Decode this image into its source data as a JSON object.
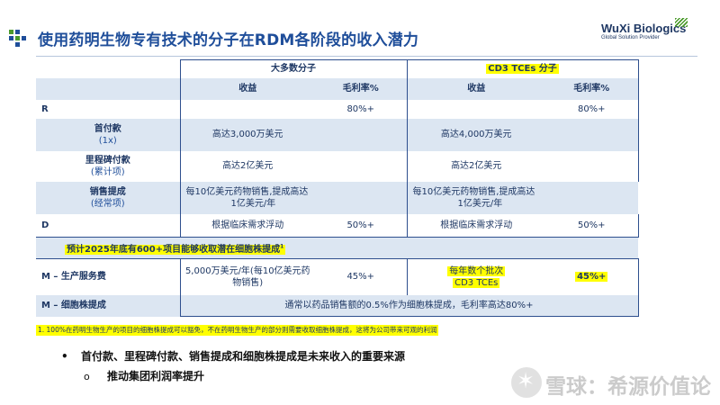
{
  "slide": {
    "title": "使用药明生物专有技术的分子在RDM各阶段的收入潜力",
    "brand": {
      "name": "WuXi Biologics",
      "tagline": "Global Solution Provider"
    },
    "colors": {
      "accent": "#1f4e9a",
      "band": "#dce6f2",
      "highlight": "#ffff00",
      "logo_green": "#4a9a2a"
    }
  },
  "table": {
    "group_headers": {
      "majority": "大多数分子",
      "cd3": "CD3 TCEs 分子"
    },
    "col_headers": {
      "revenue": "收益",
      "gross_margin": "毛利率%"
    },
    "rows": {
      "r": {
        "label": "R",
        "gm_majority": "80%+",
        "gm_cd3": "80%+"
      },
      "upfront": {
        "label": "首付款",
        "sub": "(1x)",
        "rev_majority": "高达3,000万美元",
        "rev_cd3": "高达4,000万美元"
      },
      "milestone": {
        "label": "里程碑付款",
        "sub": "(累计项)",
        "rev_majority": "高达2亿美元",
        "rev_cd3": "高达2亿美元"
      },
      "royalty": {
        "label": "销售提成",
        "sub": "(经常项)",
        "rev_majority_1": "每10亿美元药物销售,提成高达",
        "rev_majority_2": "1亿美元/年",
        "rev_cd3_1": "每10亿美元药物销售,提成高达",
        "rev_cd3_2": "1亿美元/年"
      },
      "d": {
        "label": "D",
        "rev_majority": "根据临床需求浮动",
        "gm_majority": "50%+",
        "rev_cd3": "根据临床需求浮动",
        "gm_cd3": "50%+"
      },
      "forecast": {
        "text": "预计2025年底有600+项目能够收取潜在细胞株提成",
        "sup": "1"
      },
      "mfg": {
        "label": "M – 生产服务费",
        "rev_majority_1": "5,000万美元/年(每10亿美元药",
        "rev_majority_2": "物销售)",
        "gm_majority": "45%+",
        "rev_cd3_1": "每年数个批次",
        "rev_cd3_2": "CD3 TCEs",
        "gm_cd3": "45%+"
      },
      "cellline": {
        "label": "M – 细胞株提成",
        "text": "通常以药品销售额的0.5%作为细胞株提成，毛利率高达80%+"
      }
    }
  },
  "footnote": "1. 100%在药明生物生产的项目的细胞株提成可以豁免，不在药明生物生产的部分则需要收取细胞株提成，这将为公司带来可观的利润",
  "bullets": {
    "level1": {
      "marker": "•",
      "text": "首付款、里程碑付款、销售提成和细胞株提成是未来收入的重要来源"
    },
    "level2": {
      "marker": "o",
      "text": "推动集团利润率提升"
    }
  },
  "watermark": {
    "text": "雪球：希源价值论",
    "icon": "snowflake-icon"
  }
}
